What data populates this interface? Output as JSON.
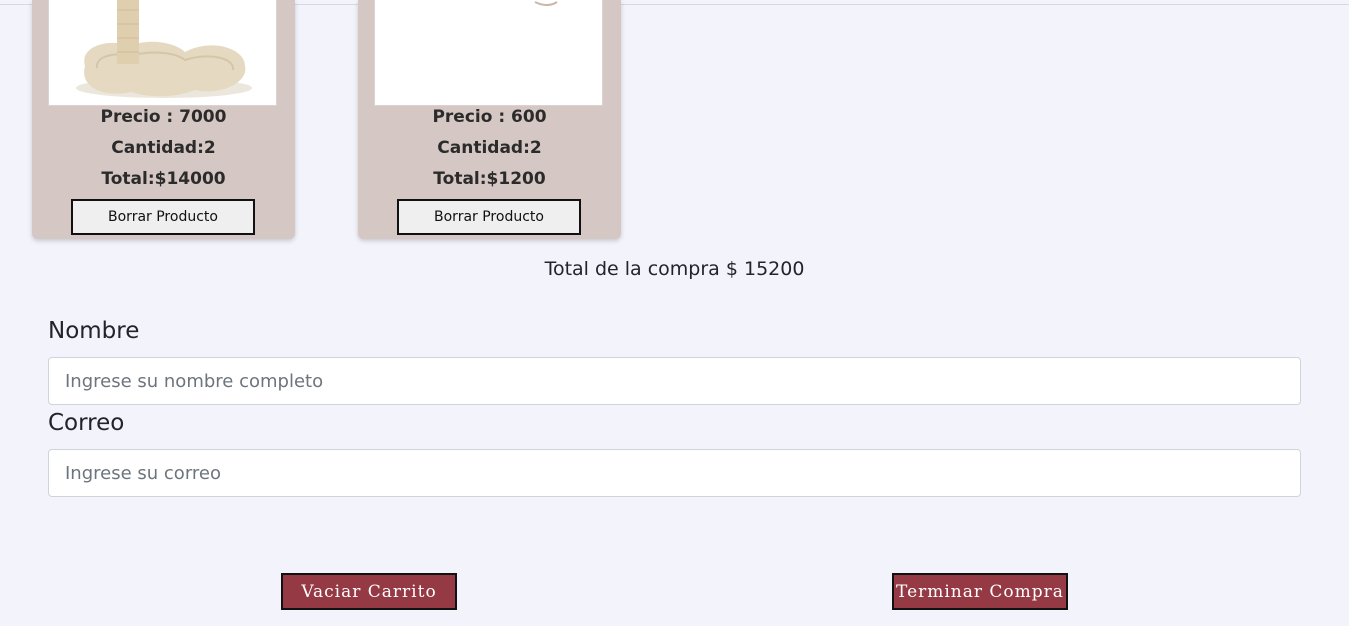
{
  "cart": {
    "items": [
      {
        "image_icon": "cat-scratching-post-image",
        "price_text": "Precio : 7000",
        "quantity_text": "Cantidad:2",
        "total_text": "Total:$14000",
        "delete_label": "Borrar Producto"
      },
      {
        "image_icon": "product-image",
        "price_text": "Precio : 600",
        "quantity_text": "Cantidad:2",
        "total_text": "Total:$1200",
        "delete_label": "Borrar Producto"
      }
    ],
    "total_text": "Total de la compra $ 15200"
  },
  "form": {
    "name_label": "Nombre",
    "name_placeholder": "Ingrese su nombre completo",
    "name_value": "",
    "email_label": "Correo",
    "email_placeholder": "Ingrese su correo",
    "email_value": ""
  },
  "actions": {
    "empty_cart_label": "Vaciar Carrito",
    "finish_purchase_label": "Terminar Compra"
  },
  "colors": {
    "page_background": "#f3f3fb",
    "card_background": "#d5c7c4",
    "action_button": "#953a44"
  }
}
